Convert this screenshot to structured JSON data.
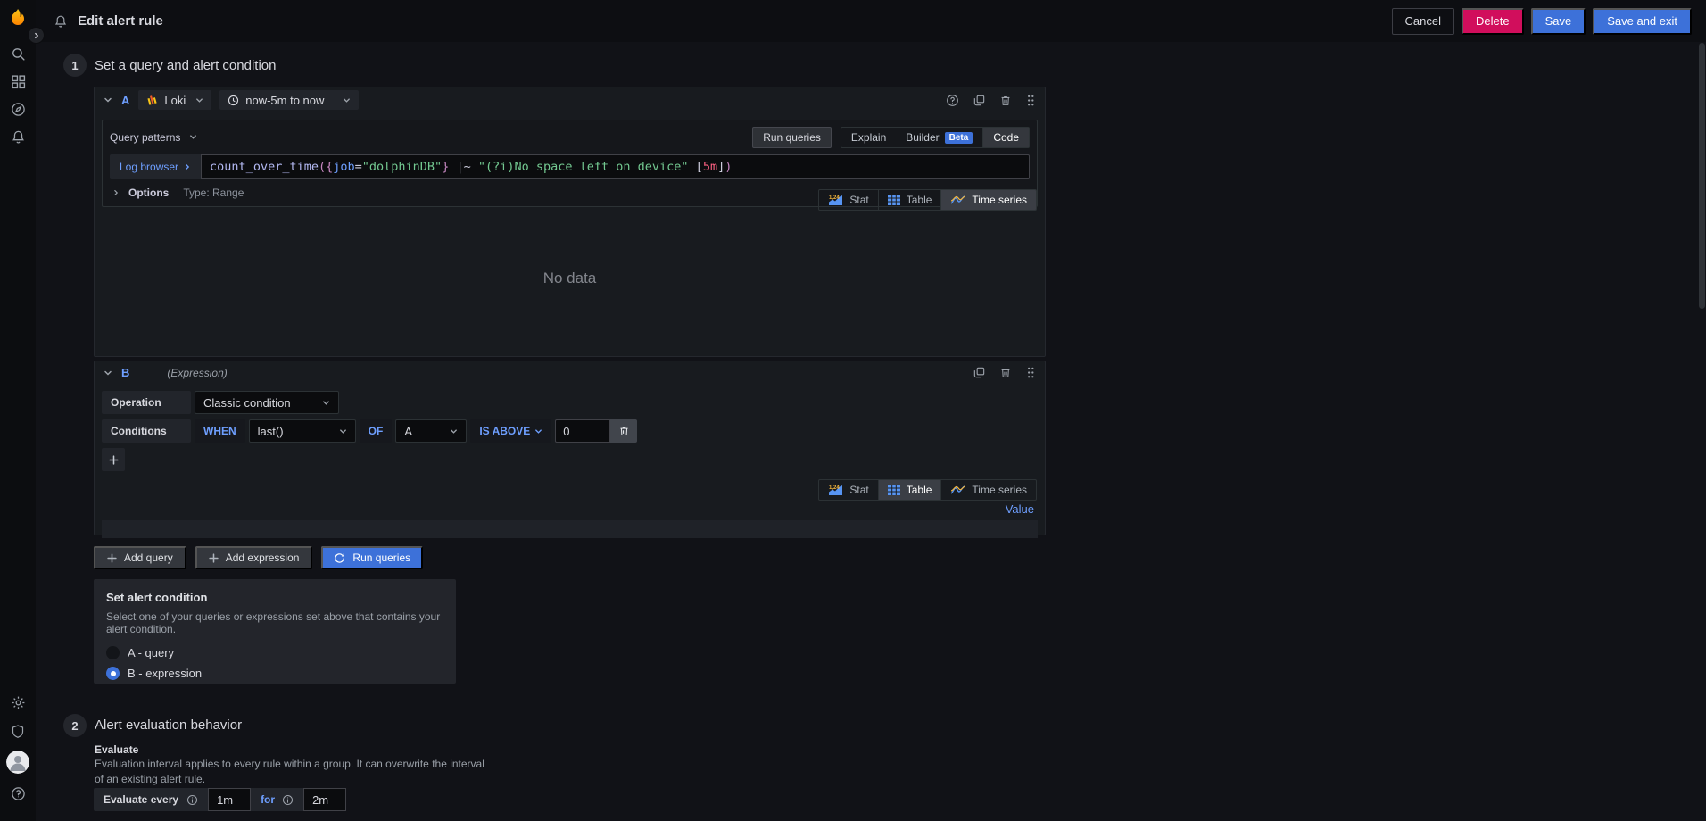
{
  "topbar": {
    "title": "Edit alert rule",
    "cancel": "Cancel",
    "delete": "Delete",
    "save": "Save",
    "save_and_exit": "Save and exit"
  },
  "sections": {
    "one": {
      "number": "1",
      "title": "Set a query and alert condition"
    },
    "two": {
      "number": "2",
      "title": "Alert evaluation behavior"
    }
  },
  "query_a": {
    "ref_id": "A",
    "datasource": "Loki",
    "time_range": "now-5m to now",
    "query_patterns_label": "Query patterns",
    "run_queries_label": "Run queries",
    "mode_tabs": {
      "explain": "Explain",
      "builder": "Builder",
      "beta_badge": "Beta",
      "code": "Code"
    },
    "log_browser_label": "Log browser",
    "query_tokens": [
      {
        "text": "count_over_time",
        "type": "fn"
      },
      {
        "text": "(",
        "type": "paren"
      },
      {
        "text": "{",
        "type": "paren"
      },
      {
        "text": "job",
        "type": "label"
      },
      {
        "text": "=",
        "type": "op"
      },
      {
        "text": "\"dolphinDB\"",
        "type": "str"
      },
      {
        "text": "}",
        "type": "paren"
      },
      {
        "text": " |~ ",
        "type": "op"
      },
      {
        "text": "\"(?i)No space left on device\"",
        "type": "str"
      },
      {
        "text": " [",
        "type": "op"
      },
      {
        "text": "5m",
        "type": "dur"
      },
      {
        "text": "]",
        "type": "op"
      },
      {
        "text": ")",
        "type": "paren"
      }
    ],
    "options_label": "Options",
    "options_summary": "Type: Range",
    "viz_tabs": [
      "Stat",
      "Table",
      "Time series"
    ],
    "no_data_text": "No data"
  },
  "expression_b": {
    "ref_id": "B",
    "type_label": "(Expression)",
    "operation_label": "Operation",
    "operation_value": "Classic condition",
    "conditions_label": "Conditions",
    "when_label": "WHEN",
    "function_value": "last()",
    "of_label": "OF",
    "input_ref": "A",
    "evaluator": "IS ABOVE",
    "threshold_value": "0",
    "viz_tabs": [
      "Stat",
      "Table",
      "Time series"
    ],
    "value_column": "Value"
  },
  "actions": {
    "add_query": "Add query",
    "add_expression": "Add expression",
    "run_queries": "Run queries"
  },
  "alert_condition": {
    "title": "Set alert condition",
    "description": "Select one of your queries or expressions set above that contains your alert condition.",
    "options": [
      {
        "label": "A - query",
        "selected": false
      },
      {
        "label": "B - expression",
        "selected": true
      }
    ]
  },
  "evaluation": {
    "evaluate_label": "Evaluate",
    "description": "Evaluation interval applies to every rule within a group. It can overwrite the interval of an existing alert rule.",
    "evaluate_every_label": "Evaluate every",
    "evaluate_every_value": "1m",
    "for_label": "for",
    "for_value": "2m"
  },
  "colors": {
    "accent_blue": "#3d71d9",
    "delete_red": "#d10e5c",
    "link_blue": "#6e9fff",
    "string_green": "#73c991",
    "duration_pink": "#ff6183"
  }
}
